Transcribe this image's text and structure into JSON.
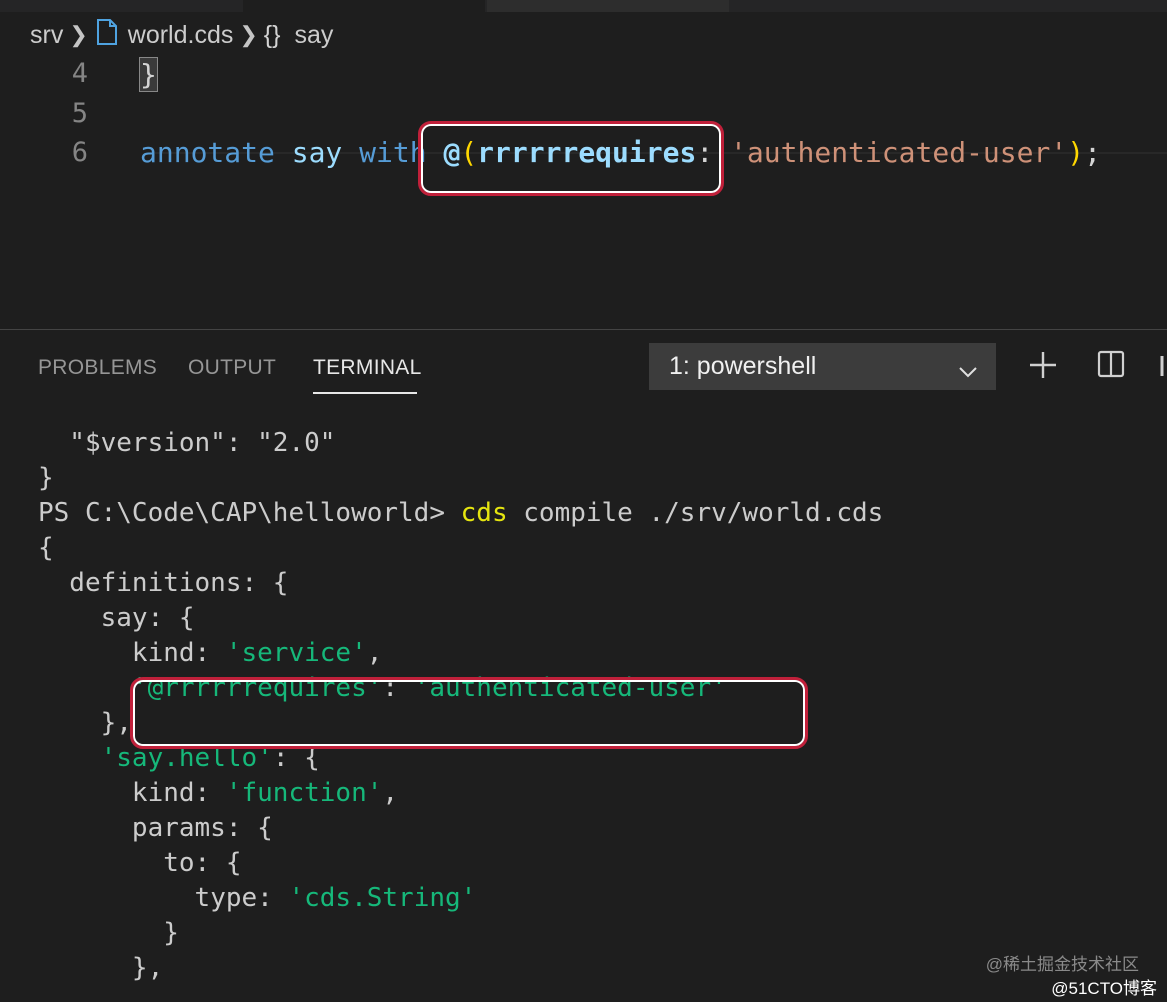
{
  "breadcrumb": {
    "folder": "srv",
    "file": "world.cds",
    "symbol_icon": "{}",
    "symbol": "say"
  },
  "editor": {
    "lines": [
      {
        "number": "4",
        "text": "}"
      },
      {
        "number": "5",
        "text": ""
      },
      {
        "number": "6",
        "keyword": "annotate",
        "ident": "say",
        "keyword2": "with",
        "at": "@",
        "open_paren": "(",
        "annotation": "rrrrrrequires",
        "colon": ":",
        "value": "'authenticated-user'",
        "close_paren": ")",
        "semicolon": ";"
      }
    ]
  },
  "panel": {
    "tabs": [
      "PROBLEMS",
      "OUTPUT",
      "TERMINAL"
    ],
    "active_tab": "TERMINAL",
    "terminal_select": "1: powershell"
  },
  "terminal": {
    "lines": [
      "  \"$version\": \"2.0\"",
      "}",
      {
        "prompt": "PS C:\\Code\\CAP\\helloworld> ",
        "cmd": "cds",
        "args": " compile ./srv/world.cds"
      },
      "{",
      "  definitions: {",
      "    say: {",
      {
        "indent": "      ",
        "key": "kind: ",
        "val": "'service'",
        "tail": ","
      },
      {
        "indent": "      ",
        "key_str": "'@rrrrrrequires'",
        "sep": ": ",
        "val": "'authenticated-user'",
        "tail": ""
      },
      "    },",
      {
        "indent": "    ",
        "key_str": "'say.hello'",
        "sep": ": {",
        "val": "",
        "tail": ""
      },
      {
        "indent": "      ",
        "key": "kind: ",
        "val": "'function'",
        "tail": ","
      },
      "      params: {",
      "        to: {",
      {
        "indent": "          ",
        "key": "type: ",
        "val": "'cds.String'",
        "tail": ""
      },
      "        }",
      "      },"
    ]
  },
  "watermark": {
    "line1": "@稀土掘金技术社区",
    "line2": "@51CTO博客"
  },
  "colors": {
    "keyword": "#569cd6",
    "string": "#ce9178",
    "term_green": "#16b87a",
    "term_yellow": "#e5e510",
    "callout": "#c0203a"
  }
}
